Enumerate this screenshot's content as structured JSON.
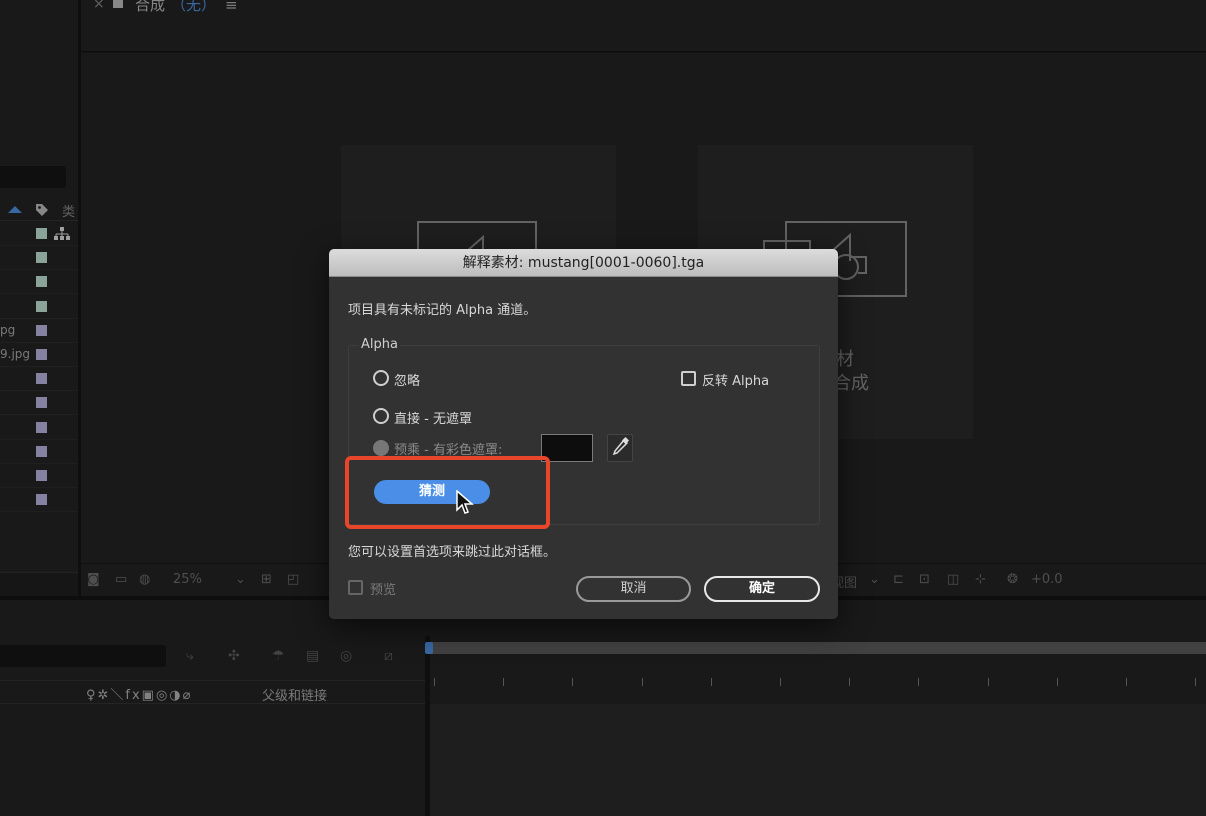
{
  "comp_panel": {
    "close": "×",
    "tab_title": "合成",
    "tab_none": "（无）",
    "menu": "≡",
    "card_right_line1": "素材",
    "card_right_line2": "合成"
  },
  "project_panel": {
    "type_col": "类",
    "rows": [
      {
        "name": "",
        "color": "#bfe3d6"
      },
      {
        "name": "",
        "color": "#bfe3d6"
      },
      {
        "name": "",
        "color": "#bfe3d6"
      },
      {
        "name": "",
        "color": "#bfe3d6"
      },
      {
        "name": "pg",
        "color": "#b9b3e0"
      },
      {
        "name": "9.jpg",
        "color": "#b9b3e0"
      },
      {
        "name": "",
        "color": "#b9b3e0"
      },
      {
        "name": "",
        "color": "#b9b3e0"
      },
      {
        "name": "",
        "color": "#b9b3e0"
      },
      {
        "name": "",
        "color": "#b9b3e0"
      },
      {
        "name": "",
        "color": "#b9b3e0"
      },
      {
        "name": "",
        "color": "#b9b3e0"
      }
    ]
  },
  "viewer_toolbar": {
    "zoom": "25%",
    "zoom_caret": "⌄",
    "exposure": "+0.0",
    "view_label": "视图"
  },
  "timeline": {
    "parent_col": "父级和链接",
    "switch_icons": "♀✲＼fx▣◎◑⌀"
  },
  "dialog": {
    "title": "解释素材: mustang[0001-0060].tga",
    "message": "项目具有未标记的 Alpha 通道。",
    "group_label": "Alpha",
    "option_ignore": "忽略",
    "option_straight": "直接 - 无遮罩",
    "option_premultiplied": "预乘 - 有彩色遮罩:",
    "invert_alpha": "反转 Alpha",
    "guess_button": "猜测",
    "hint": "您可以设置首选项来跳过此对话框。",
    "preview": "预览",
    "cancel": "取消",
    "ok": "确定"
  },
  "colors": {
    "accent": "#4a8ee8",
    "highlight": "#e8452a",
    "label_green": "#bfe3d6",
    "label_purple": "#b9b3e0"
  }
}
